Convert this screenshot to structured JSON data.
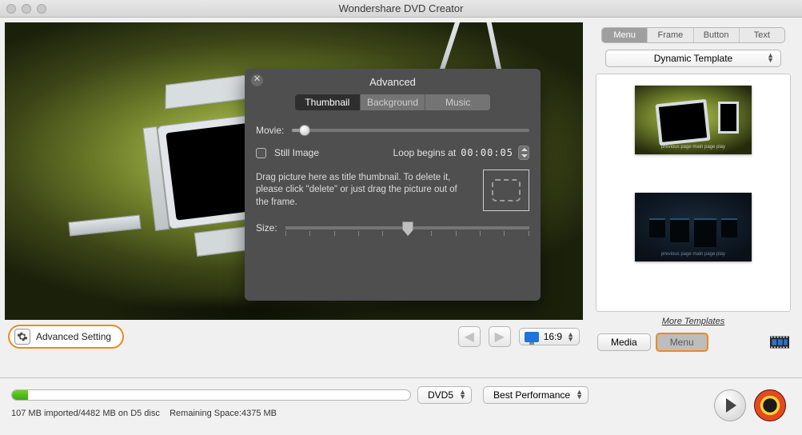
{
  "window": {
    "title": "Wondershare DVD Creator"
  },
  "preview": {
    "play_label": "play"
  },
  "advanced": {
    "title": "Advanced",
    "tabs": {
      "thumbnail": "Thumbnail",
      "background": "Background",
      "music": "Music"
    },
    "movie_label": "Movie:",
    "still_image_label": "Still Image",
    "loop_label": "Loop begins at",
    "loop_time": "00:00:05",
    "drag_hint": "Drag picture here as title thumbnail. To delete it, please click \"delete\" or just drag the picture out of the frame.",
    "size_label": "Size:"
  },
  "toolbar": {
    "advanced_setting": "Advanced Setting",
    "aspect": "16:9"
  },
  "sidebar": {
    "tabs": {
      "menu": "Menu",
      "frame": "Frame",
      "button": "Button",
      "text": "Text"
    },
    "template_dd": "Dynamic Template",
    "thumb1_caption": "previous page  main page  play",
    "thumb2_caption": "previous page  main page  play",
    "more": "More Templates",
    "media": "Media",
    "menu_btn": "Menu"
  },
  "bottom": {
    "disc_type": "DVD5",
    "quality": "Best Performance",
    "status_left": "107 MB imported/4482 MB on D5 disc",
    "status_right": "Remaining Space:4375 MB",
    "progress_pct": 4
  }
}
